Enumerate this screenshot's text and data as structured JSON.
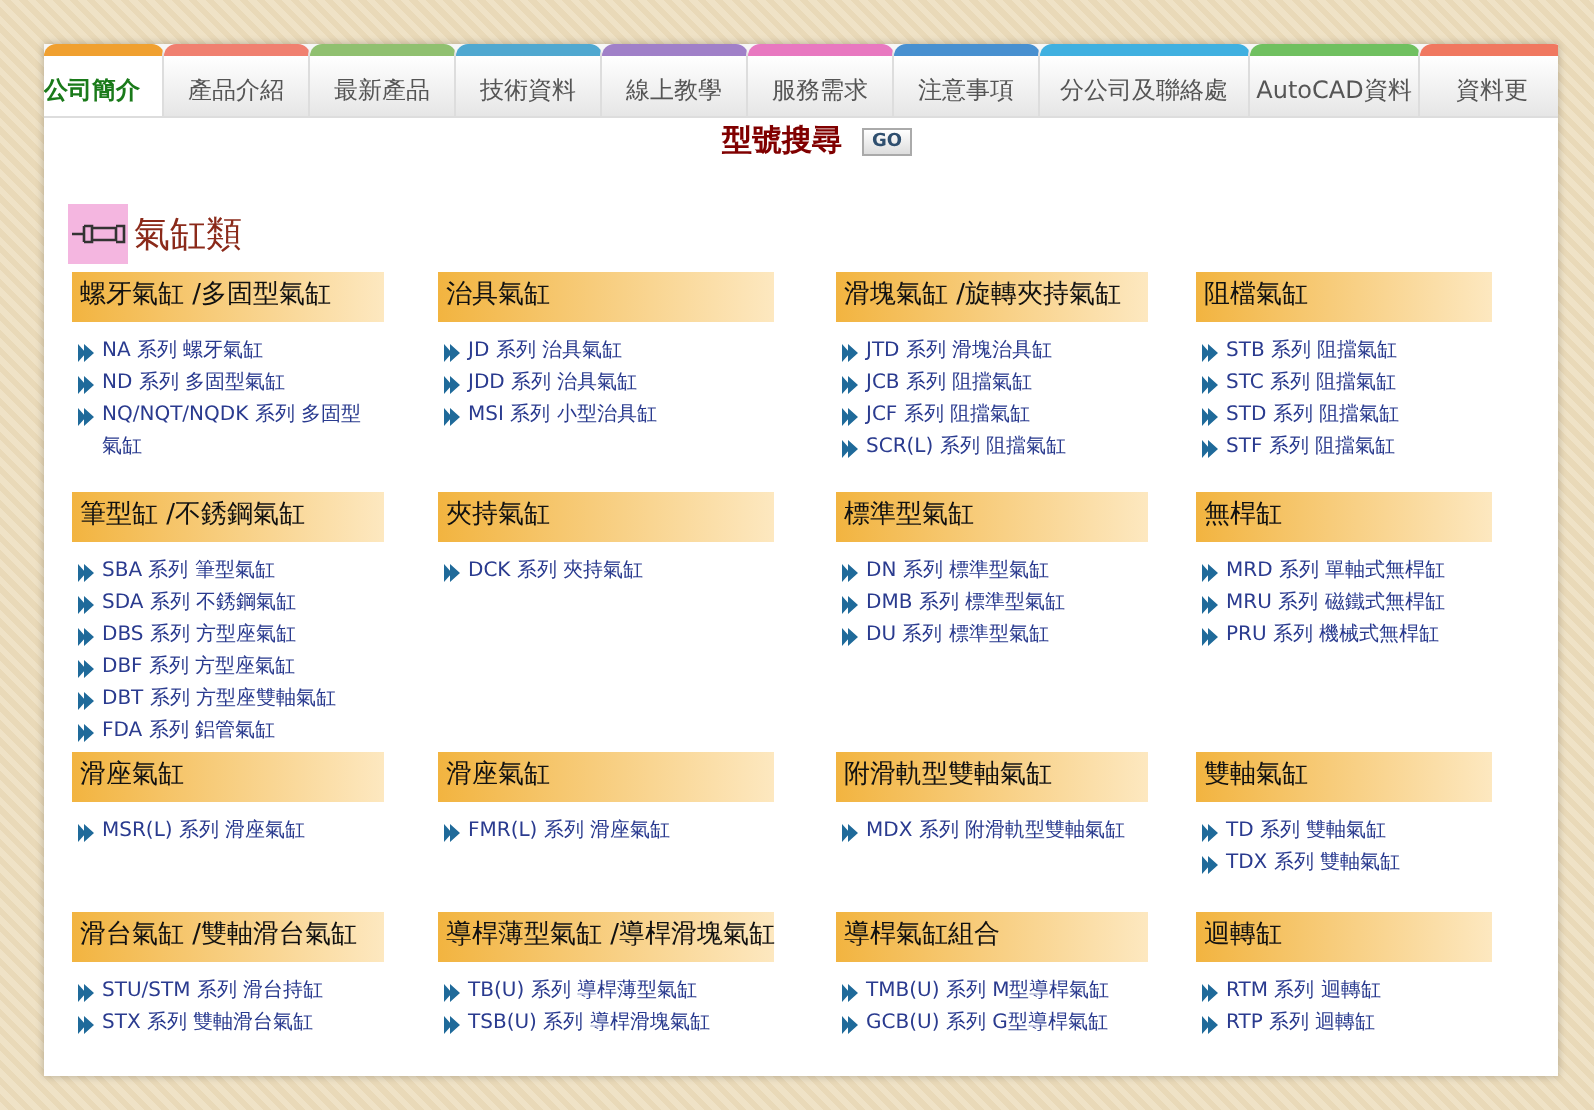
{
  "nav": {
    "tabs": [
      {
        "label": "公司簡介",
        "selected": true,
        "color": "#f0a030"
      },
      {
        "label": "產品介紹",
        "selected": false,
        "color": "#f08070"
      },
      {
        "label": "最新產品",
        "selected": false,
        "color": "#90c070"
      },
      {
        "label": "技術資料",
        "selected": false,
        "color": "#50a8d0"
      },
      {
        "label": "線上教學",
        "selected": false,
        "color": "#a080c8"
      },
      {
        "label": "服務需求",
        "selected": false,
        "color": "#e878c0"
      },
      {
        "label": "注意事項",
        "selected": false,
        "color": "#4890d0"
      },
      {
        "label": "分公司及聯絡處",
        "selected": false,
        "color": "#40b0e0"
      },
      {
        "label": "AutoCAD資料",
        "selected": false,
        "color": "#70c060"
      },
      {
        "label": "資料更",
        "selected": false,
        "color": "#f07860"
      }
    ]
  },
  "search": {
    "title": "型號搜尋",
    "button": "GO"
  },
  "section": {
    "title": "氣缸類"
  },
  "categories": [
    {
      "title": "螺牙氣缸 /多固型氣缸",
      "items": [
        "NA 系列 螺牙氣缸",
        "ND 系列 多固型氣缸",
        "NQ/NQT/NQDK 系列 多固型氣缸"
      ]
    },
    {
      "title": "治具氣缸",
      "items": [
        "JD 系列 治具氣缸",
        "JDD 系列 治具氣缸",
        "MSI 系列 小型治具缸"
      ]
    },
    {
      "title": "滑塊氣缸 /旋轉夾持氣缸",
      "items": [
        "JTD 系列 滑塊治具缸",
        "JCB 系列 阻擋氣缸",
        "JCF 系列 阻擋氣缸",
        "SCR(L) 系列 阻擋氣缸"
      ]
    },
    {
      "title": "阻檔氣缸",
      "items": [
        "STB 系列 阻擋氣缸",
        "STC 系列 阻擋氣缸",
        "STD 系列 阻擋氣缸",
        "STF 系列 阻擋氣缸"
      ]
    },
    {
      "title": "筆型缸 /不銹鋼氣缸",
      "items": [
        "SBA 系列 筆型氣缸",
        "SDA 系列 不銹鋼氣缸",
        "DBS 系列 方型座氣缸",
        "DBF 系列 方型座氣缸",
        "DBT 系列 方型座雙軸氣缸",
        "FDA 系列 鋁管氣缸"
      ]
    },
    {
      "title": "夾持氣缸",
      "items": [
        "DCK 系列 夾持氣缸"
      ]
    },
    {
      "title": "標準型氣缸",
      "items": [
        "DN 系列 標準型氣缸",
        "DMB 系列 標準型氣缸",
        "DU 系列 標準型氣缸"
      ]
    },
    {
      "title": "無桿缸",
      "items": [
        "MRD 系列 單軸式無桿缸",
        "MRU 系列 磁鐵式無桿缸",
        "PRU 系列 機械式無桿缸"
      ]
    },
    {
      "title": "滑座氣缸",
      "items": [
        "MSR(L) 系列 滑座氣缸"
      ]
    },
    {
      "title": "滑座氣缸",
      "items": [
        "FMR(L) 系列 滑座氣缸"
      ]
    },
    {
      "title": "附滑軌型雙軸氣缸",
      "items": [
        "MDX 系列 附滑軌型雙軸氣缸"
      ]
    },
    {
      "title": "雙軸氣缸",
      "items": [
        "TD 系列 雙軸氣缸",
        "TDX 系列 雙軸氣缸"
      ]
    },
    {
      "title": "滑台氣缸 /雙軸滑台氣缸",
      "items": [
        "STU/STM 系列 滑台持缸",
        "STX 系列 雙軸滑台氣缸"
      ]
    },
    {
      "title": "導桿薄型氣缸 /導桿滑塊氣缸",
      "items": [
        "TB(U) 系列 導桿薄型氣缸",
        "TSB(U) 系列 導桿滑塊氣缸"
      ]
    },
    {
      "title": "導桿氣缸組合",
      "items": [
        "TMB(U) 系列 M型導桿氣缸",
        "GCB(U) 系列 G型導桿氣缸"
      ]
    },
    {
      "title": "迴轉缸",
      "items": [
        "RTM 系列 迴轉缸",
        "RTP 系列 迴轉缸"
      ]
    }
  ]
}
